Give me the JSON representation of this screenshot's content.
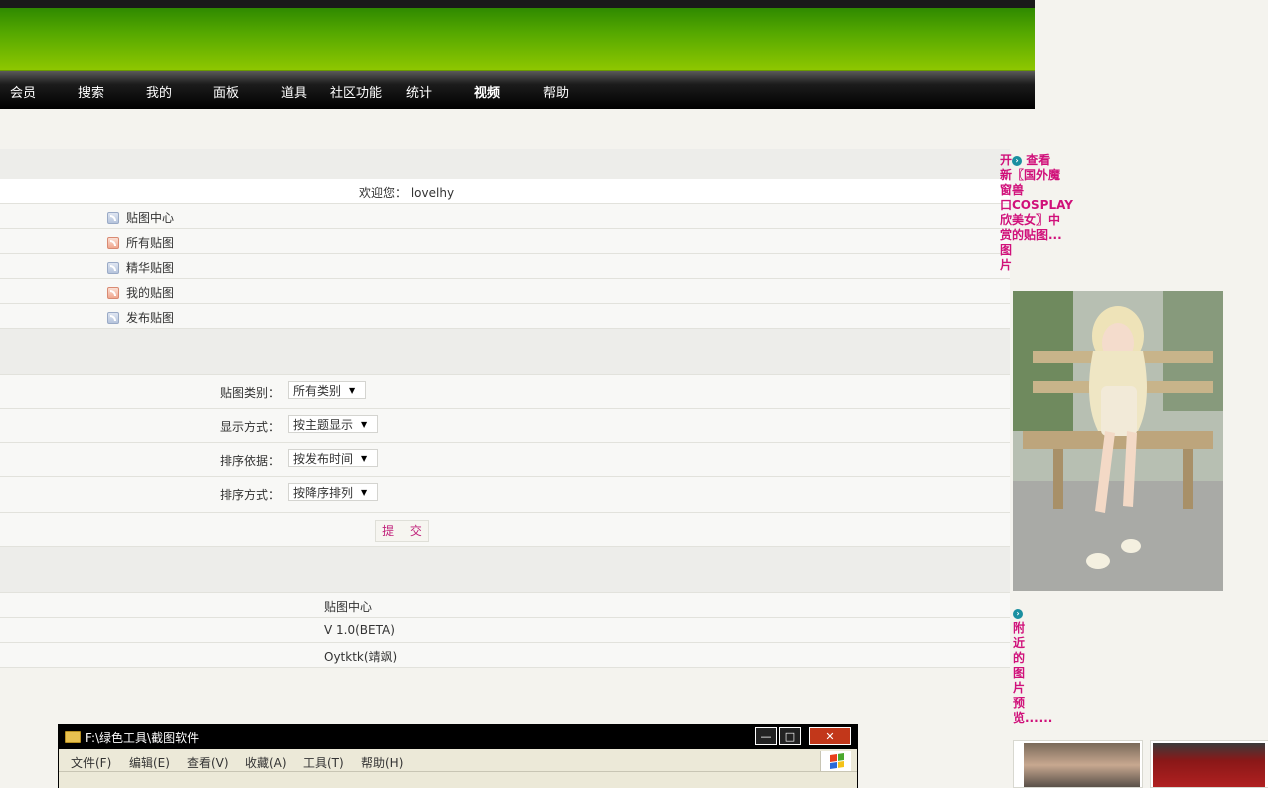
{
  "nav": {
    "items": [
      {
        "label": "会员",
        "active": false
      },
      {
        "label": "搜索",
        "active": false
      },
      {
        "label": "我的",
        "active": false
      },
      {
        "label": "面板",
        "active": false
      },
      {
        "label": "道具",
        "active": false
      },
      {
        "label": "社区功能",
        "active": false
      },
      {
        "label": "统计",
        "active": false
      },
      {
        "label": "视频",
        "active": true
      },
      {
        "label": "帮助",
        "active": false
      }
    ]
  },
  "welcome": {
    "label": "欢迎您：",
    "user": "lovelhy"
  },
  "menu": [
    {
      "label": "贴图中心",
      "icon": "rss-blue-icon"
    },
    {
      "label": "所有贴图",
      "icon": "rss-red-icon"
    },
    {
      "label": "精华贴图",
      "icon": "rss-blue-icon"
    },
    {
      "label": "我的贴图",
      "icon": "rss-red-icon"
    },
    {
      "label": "发布贴图",
      "icon": "rss-blue-icon"
    }
  ],
  "filters": {
    "category": {
      "label": "贴图类别：",
      "value": "所有类别"
    },
    "display": {
      "label": "显示方式：",
      "value": "按主题显示"
    },
    "sort_by": {
      "label": "排序依据：",
      "value": "按发布时间"
    },
    "sort_order": {
      "label": "排序方式：",
      "value": "按降序排列"
    },
    "submit": "提 交"
  },
  "info": {
    "name": "贴图中心",
    "version": "V 1.0(BETA)",
    "author": "Oytktk(靖飒)"
  },
  "sidebar": {
    "promo_lines": [
      "开",
      "新〖国外魔",
      "窗兽",
      "口COSPLAY",
      "欣美女〗中",
      "赏的贴图...",
      "图",
      "片"
    ],
    "promo_view": "查看",
    "nearby_lines": [
      "附",
      "近",
      "的",
      "图",
      "片",
      "预",
      "览......"
    ]
  },
  "explorer_window": {
    "title": "F:\\绿色工具\\截图软件",
    "menu": [
      "文件(F)",
      "编辑(E)",
      "查看(V)",
      "收藏(A)",
      "工具(T)",
      "帮助(H)"
    ]
  },
  "colors": {
    "accent_pink": "#d0107a",
    "banner_green": "#55a800",
    "nav_black": "#000000"
  }
}
